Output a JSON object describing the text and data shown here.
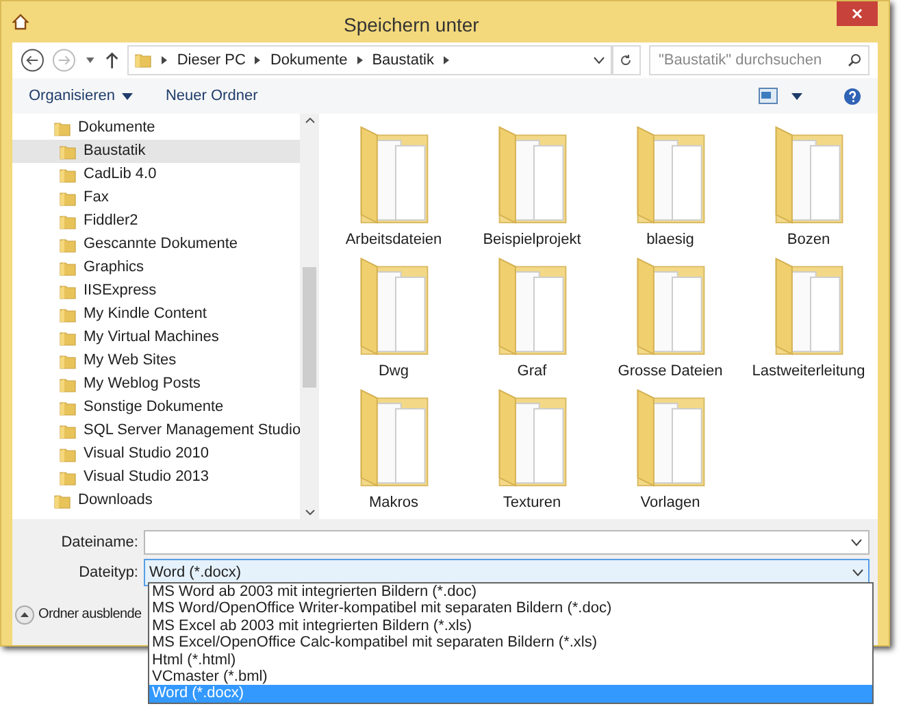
{
  "window": {
    "title": "Speichern unter"
  },
  "address_bar": {
    "path": [
      "Dieser PC",
      "Dokumente",
      "Baustatik"
    ]
  },
  "search": {
    "placeholder": "\"Baustatik\" durchsuchen"
  },
  "toolbar": {
    "buttons": [
      "Organisieren",
      "Neuer Ordner"
    ]
  },
  "tree": [
    {
      "label": "Dokumente",
      "selected": false,
      "children": [
        {
          "label": "Baustatik",
          "selected": true
        },
        {
          "label": "CadLib 4.0",
          "selected": false
        },
        {
          "label": "Fax",
          "selected": false
        },
        {
          "label": "Fiddler2",
          "selected": false
        },
        {
          "label": "Gescannte Dokumente",
          "selected": false
        },
        {
          "label": "Graphics",
          "selected": false
        },
        {
          "label": "IISExpress",
          "selected": false
        },
        {
          "label": "My Kindle Content",
          "selected": false
        },
        {
          "label": "My Virtual Machines",
          "selected": false
        },
        {
          "label": "My Web Sites",
          "selected": false
        },
        {
          "label": "My Weblog Posts",
          "selected": false
        },
        {
          "label": "Sonstige Dokumente",
          "selected": false
        },
        {
          "label": "SQL Server Management Studio",
          "selected": false
        },
        {
          "label": "Visual Studio 2010",
          "selected": false
        },
        {
          "label": "Visual Studio 2013",
          "selected": false
        }
      ]
    },
    {
      "label": "Downloads",
      "selected": false
    }
  ],
  "folders": [
    "Arbeitsdateien",
    "Beispielprojekt",
    "blaesig",
    "Bozen",
    "Dwg",
    "Graf",
    "Grosse Dateien",
    "Lastweiterleitung",
    "Makros",
    "Texturen",
    "Vorlagen"
  ],
  "filename": {
    "label": "Dateiname:"
  },
  "filetype": {
    "label": "Dateityp:",
    "value": "Word (*.docx)",
    "options": [
      {
        "label": "MS Word ab 2003 mit integrierten Bildern (*.doc)",
        "selected": false
      },
      {
        "label": "MS Word/OpenOffice Writer-kompatibel mit separaten Bildern (*.doc)",
        "selected": false
      },
      {
        "label": "MS Excel ab 2003 mit integrierten Bildern (*.xls)",
        "selected": false
      },
      {
        "label": "MS Excel/OpenOffice Calc-kompatibel mit separaten Bildern (*.xls)",
        "selected": false
      },
      {
        "label": "Html (*.html)",
        "selected": false
      },
      {
        "label": "VCmaster (*.bml)",
        "selected": false
      },
      {
        "label": "Word (*.docx)",
        "selected": true
      }
    ]
  },
  "hide_folders": {
    "label": "Ordner ausblende"
  }
}
